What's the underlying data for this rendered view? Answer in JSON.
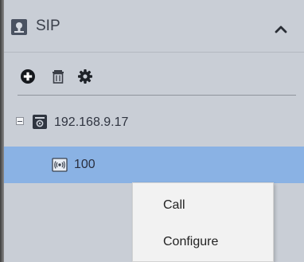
{
  "panel": {
    "title": "SIP",
    "header_icon": "sip-device-icon",
    "collapse_icon": "chevron-up-icon"
  },
  "toolbar": {
    "add_icon": "add-icon",
    "delete_icon": "trash-icon",
    "settings_icon": "gear-icon"
  },
  "tree": {
    "device": {
      "label": "192.168.9.17",
      "expanded": true,
      "icon": "server-icon"
    },
    "selected_item": {
      "label": "100",
      "icon": "broadcast-icon"
    }
  },
  "context_menu": {
    "items": [
      "Call",
      "Configure"
    ]
  },
  "colors": {
    "header_bg": "#c9ced6",
    "selected_bg": "#8ab2e4",
    "menu_bg": "#f2f2f2"
  }
}
